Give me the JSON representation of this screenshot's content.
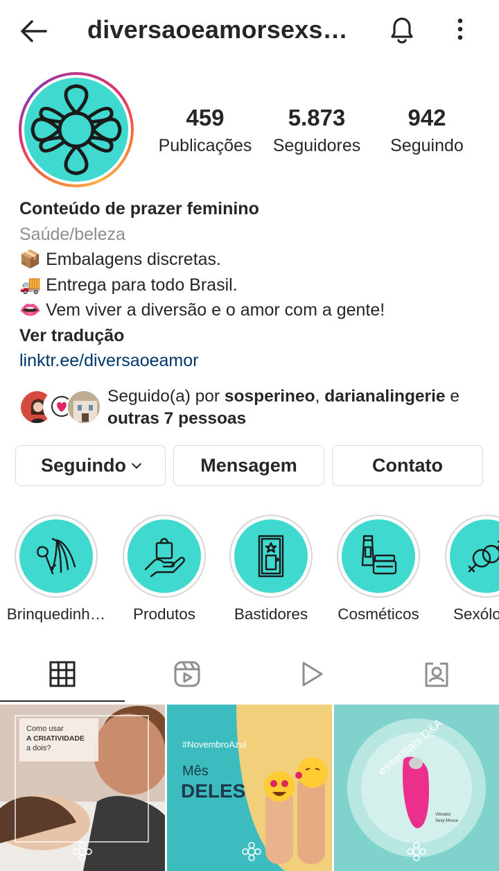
{
  "header": {
    "username": "diversaoeamorsexs…",
    "icons": [
      "arrow-left-icon",
      "bell-icon",
      "more-vertical-icon"
    ]
  },
  "profile": {
    "stats": {
      "posts": {
        "value": "459",
        "label": "Publicações"
      },
      "followers": {
        "value": "5.873",
        "label": "Seguidores"
      },
      "following": {
        "value": "942",
        "label": "Seguindo"
      }
    },
    "bio": {
      "name": "Conteúdo de prazer feminino",
      "category": "Saúde/beleza",
      "lines": [
        {
          "emoji": "📦",
          "text": "Embalagens discretas."
        },
        {
          "emoji": "🚚",
          "text": "Entrega para todo Brasil."
        },
        {
          "emoji": "👄",
          "text": "Vem viver a diversão e o amor com a gente!"
        }
      ],
      "translate": "Ver tradução",
      "link": "linktr.ee/diversaoeamor"
    },
    "followed_by": {
      "prefix": "Seguido(a) por ",
      "user1": "sosperineo",
      "sep": ", ",
      "user2": "darianalingerie",
      "conj": " e",
      "others": "outras 7 pessoas"
    }
  },
  "buttons": {
    "following": "Seguindo",
    "message": "Mensagem",
    "contact": "Contato"
  },
  "highlights": [
    {
      "label": "Brinquedinh…",
      "icon": "toys-icon"
    },
    {
      "label": "Produtos",
      "icon": "shopping-bag-hand-icon"
    },
    {
      "label": "Bastidores",
      "icon": "door-star-icon"
    },
    {
      "label": "Cosméticos",
      "icon": "cosmetics-icon"
    },
    {
      "label": "Sexólo",
      "icon": "gender-symbols-icon"
    }
  ],
  "tabs": [
    {
      "name": "grid-icon",
      "active": true
    },
    {
      "name": "reels-icon",
      "active": false
    },
    {
      "name": "video-play-icon",
      "active": false
    },
    {
      "name": "tagged-icon",
      "active": false
    }
  ],
  "posts": [
    {
      "texts": [
        "Como usar",
        "A CRIATIVIDADE",
        "a dois?"
      ]
    },
    {
      "texts": [
        "#NovembroAzul",
        "Mês",
        "DELES"
      ]
    },
    {
      "texts": [
        "essentials D&A",
        "Vibrador",
        "Sexy Mouse"
      ]
    }
  ],
  "colors": {
    "brand_teal": "#3fd9cf",
    "link": "#00376b",
    "muted": "#8e8e8e"
  }
}
